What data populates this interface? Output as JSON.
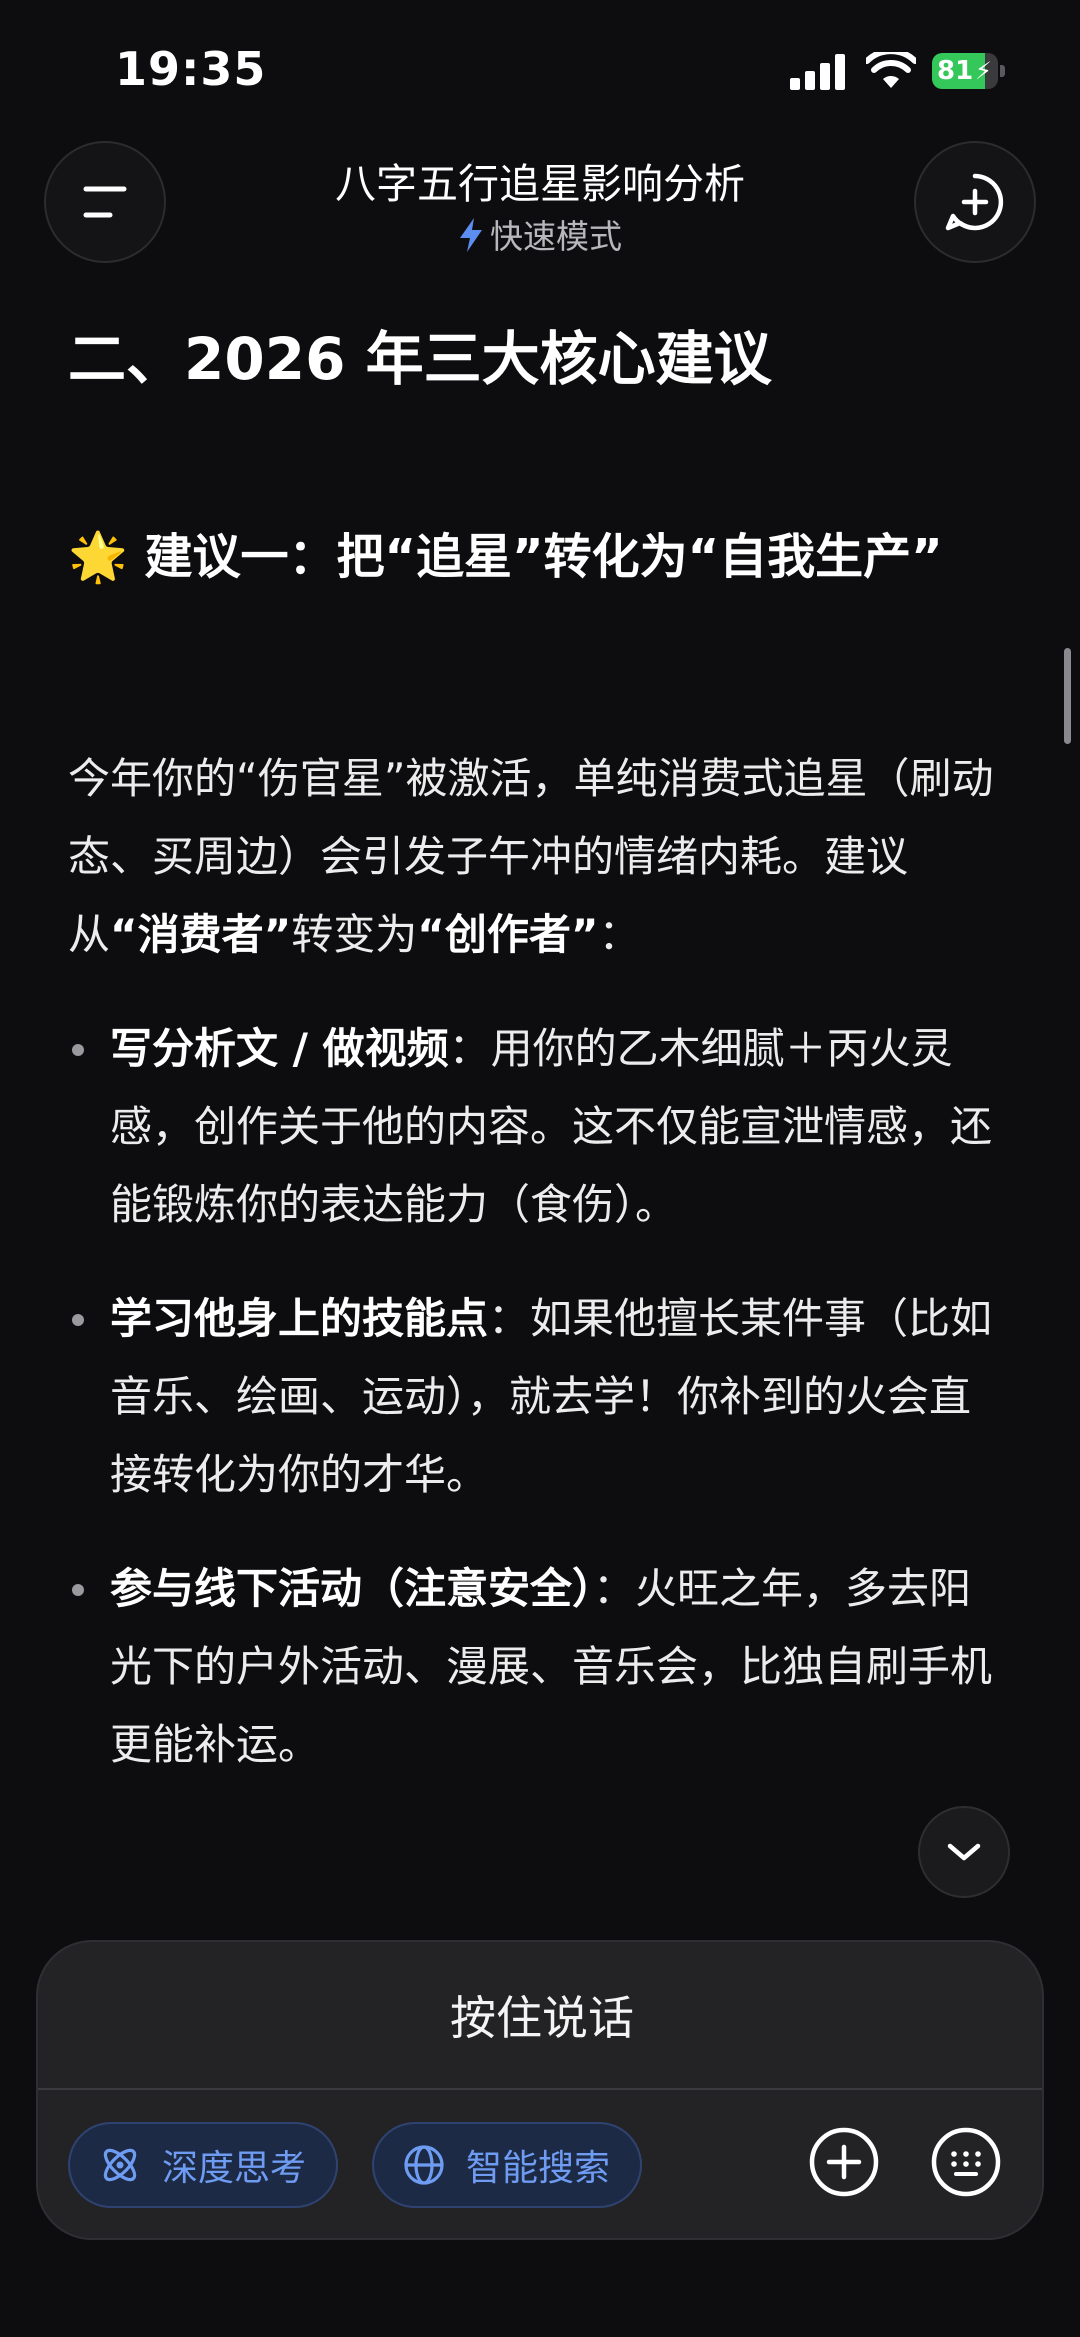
{
  "status_bar": {
    "time": "19:35",
    "battery": "81",
    "battery_level": 0.81
  },
  "header": {
    "title": "八字五行追星影响分析",
    "mode_label": "快速模式"
  },
  "content": {
    "section_title": "二、2026 年三大核心建议",
    "suggestion_emoji": "🌟",
    "suggestion_title": "建议一：把“追星”转化为“自我生产”",
    "intro_part1": "今年你的“伤官星”被激活，单纯消费式追星（刷动态、买周边）会引发子午冲的情绪内耗。建议从",
    "intro_bold1": "“消费者”",
    "intro_part2": "转变为",
    "intro_bold2": "“创作者”",
    "intro_part3": "：",
    "bullets": [
      {
        "bold": "写分析文 / 做视频",
        "text": "：用你的乙木细腻＋丙火灵感，创作关于他的内容。这不仅能宣泄情感，还能锻炼你的表达能力（食伤）。"
      },
      {
        "bold": "学习他身上的技能点",
        "text": "：如果他擅长某件事（比如音乐、绘画、运动），就去学！你补到的火会直接转化为你的才华。"
      },
      {
        "bold": "参与线下活动（注意安全）",
        "text": "：火旺之年，多去阳光下的户外活动、漫展、音乐会，比独自刷手机更能补运。"
      }
    ]
  },
  "input_panel": {
    "hold_to_talk": "按住说话",
    "deep_think_label": "深度思考",
    "smart_search_label": "智能搜索"
  },
  "colors": {
    "accent": "#6f9cf3",
    "battery": "#34c759",
    "background": "#0d0d0f"
  }
}
